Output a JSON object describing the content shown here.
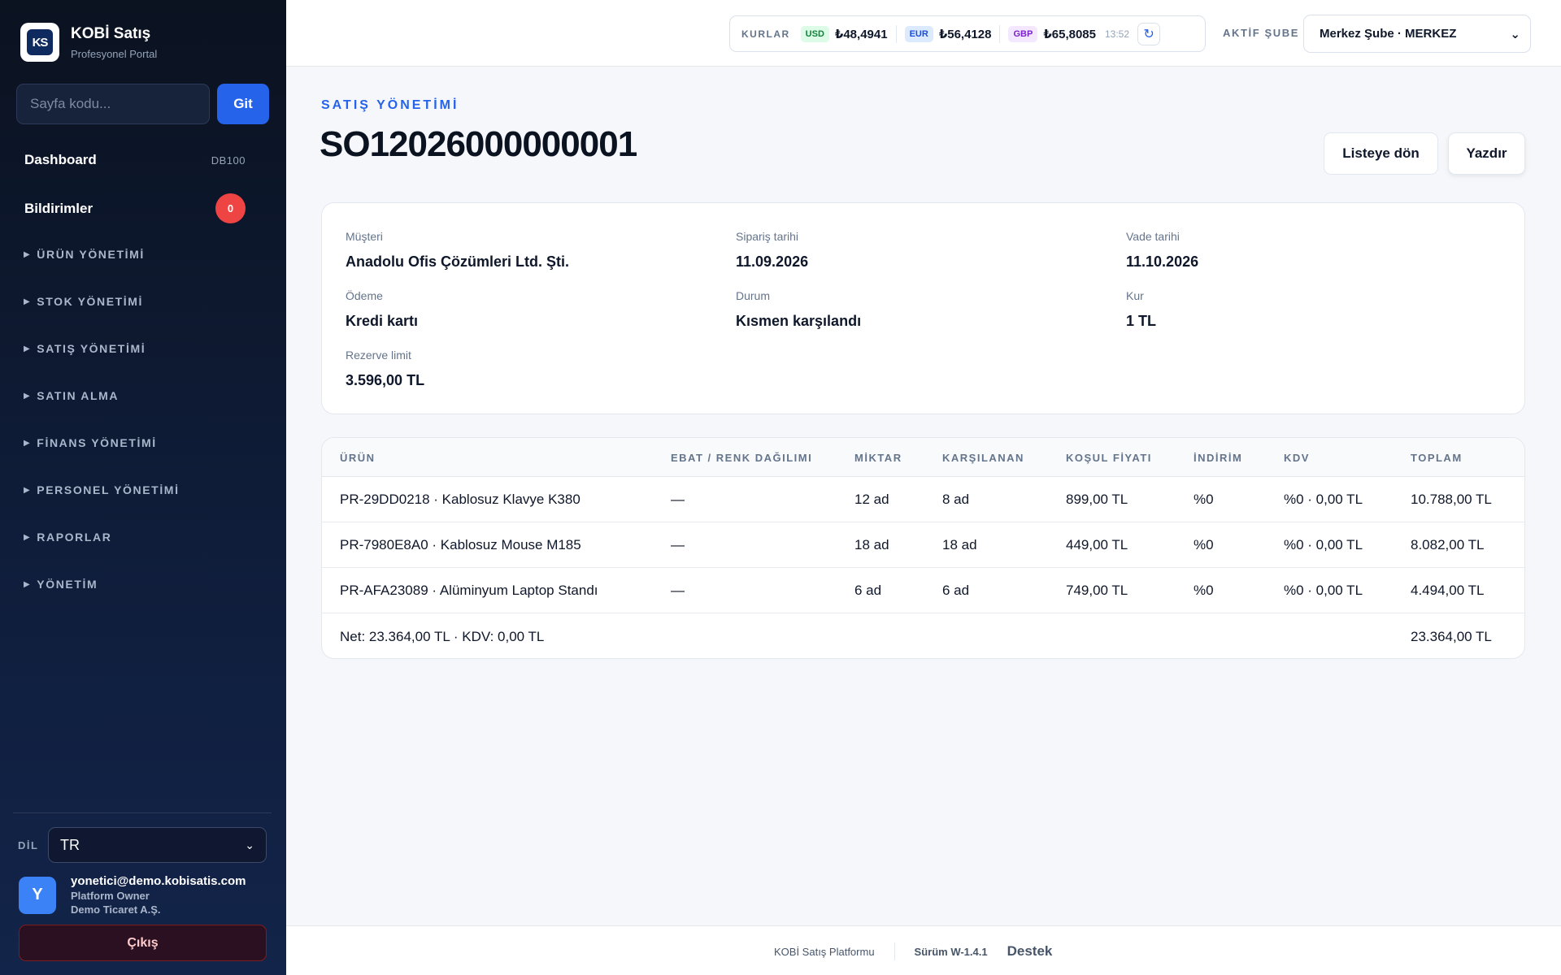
{
  "brand": {
    "title": "KOBİ Satış",
    "subtitle": "Profesyonel Portal",
    "logo_text": "KS"
  },
  "goto": {
    "placeholder": "Sayfa kodu...",
    "button": "Git"
  },
  "nav": {
    "dashboard": {
      "label": "Dashboard",
      "code": "DB100"
    },
    "notifications": {
      "label": "Bildirimler",
      "count": "0"
    },
    "groups": [
      "ÜRÜN YÖNETİMİ",
      "STOK YÖNETİMİ",
      "SATIŞ YÖNETİMİ",
      "SATIN ALMA",
      "FİNANS YÖNETİMİ",
      "PERSONEL YÖNETİMİ",
      "RAPORLAR",
      "YÖNETİM"
    ]
  },
  "language": {
    "label": "DİL",
    "value": "TR"
  },
  "user": {
    "initial": "Y",
    "email": "yonetici@demo.kobisatis.com",
    "role": "Platform Owner",
    "company": "Demo Ticaret A.Ş."
  },
  "logout_label": "Çıkış",
  "rates": {
    "label": "KURLAR",
    "items": [
      {
        "code": "USD",
        "value": "₺48,4941"
      },
      {
        "code": "EUR",
        "value": "₺56,4128"
      },
      {
        "code": "GBP",
        "value": "₺65,8085"
      }
    ],
    "time": "13:52"
  },
  "branch": {
    "label": "AKTİF ŞUBE",
    "value": "Merkez Şube · MERKEZ"
  },
  "page": {
    "eyebrow": "SATIŞ YÖNETİMİ",
    "title": "SO12026000000001",
    "back_label": "Listeye dön",
    "print_label": "Yazdır"
  },
  "order": {
    "customer": {
      "label": "Müşteri",
      "value": "Anadolu Ofis Çözümleri Ltd. Şti."
    },
    "order_date": {
      "label": "Sipariş tarihi",
      "value": "11.09.2026"
    },
    "due_date": {
      "label": "Vade tarihi",
      "value": "11.10.2026"
    },
    "payment": {
      "label": "Ödeme",
      "value": "Kredi kartı"
    },
    "status": {
      "label": "Durum",
      "value": "Kısmen karşılandı"
    },
    "rate": {
      "label": "Kur",
      "value": "1 TL"
    },
    "reserve_limit": {
      "label": "Rezerve limit",
      "value": "3.596,00 TL"
    }
  },
  "table": {
    "columns": [
      "ÜRÜN",
      "EBAT / RENK DAĞILIMI",
      "MİKTAR",
      "KARŞILANAN",
      "KOŞUL FİYATI",
      "İNDİRİM",
      "KDV",
      "TOPLAM"
    ],
    "rows": [
      [
        "PR-29DD0218 · Kablosuz Klavye K380",
        "—",
        "12 ad",
        "8 ad",
        "899,00 TL",
        "%0",
        "%0 · 0,00 TL",
        "10.788,00 TL"
      ],
      [
        "PR-7980E8A0 · Kablosuz Mouse M185",
        "—",
        "18 ad",
        "18 ad",
        "449,00 TL",
        "%0",
        "%0 · 0,00 TL",
        "8.082,00 TL"
      ],
      [
        "PR-AFA23089 · Alüminyum Laptop Standı",
        "—",
        "6 ad",
        "6 ad",
        "749,00 TL",
        "%0",
        "%0 · 0,00 TL",
        "4.494,00 TL"
      ]
    ],
    "footer_summary": "Net: 23.364,00 TL · KDV: 0,00 TL",
    "footer_total": "23.364,00 TL"
  },
  "footer": {
    "platform": "KOBİ Satış Platformu",
    "version": "Sürüm W-1.4.1",
    "support": "Destek"
  },
  "colors": {
    "accent": "#2563eb",
    "danger": "#ef4444",
    "sidebar_bg": "#0f1d3a"
  },
  "icons": {
    "refresh": "refresh-icon",
    "select": "chevron-down-icon",
    "nav_caret": "caret-right-icon"
  }
}
